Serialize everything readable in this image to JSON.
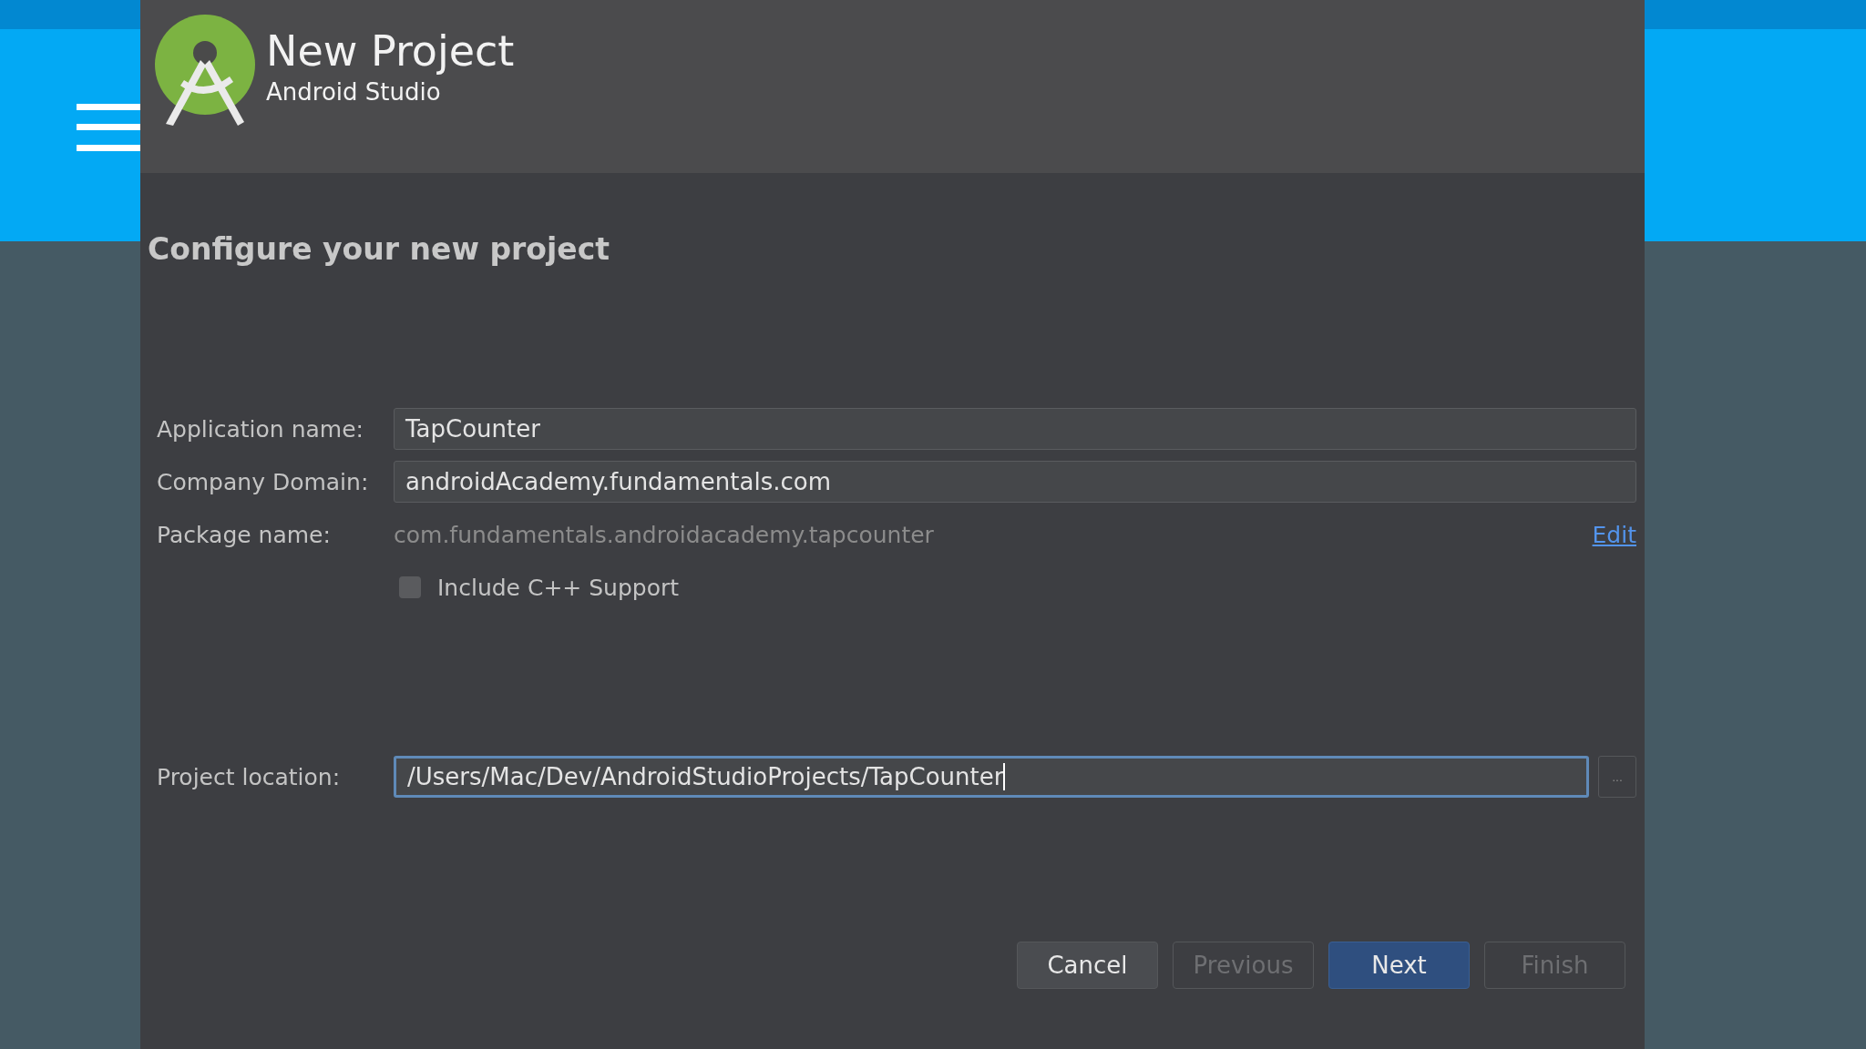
{
  "header": {
    "title": "New Project",
    "subtitle": "Android Studio"
  },
  "heading": "Configure your new project",
  "fields": [
    {
      "kind": "input",
      "label": "Application name:",
      "value": "TapCounter",
      "focused": false
    },
    {
      "kind": "input",
      "label": "Company Domain:",
      "value": "androidAcademy.fundamentals.com",
      "focused": false
    },
    {
      "kind": "readonly",
      "label": "Package name:",
      "value": "com.fundamentals.androidacademy.tapcounter",
      "link": "Edit"
    },
    {
      "kind": "checkbox",
      "label": "Include C++ Support",
      "checked": false
    }
  ],
  "location": {
    "label": "Project location:",
    "value": "/Users/Mac/Dev/AndroidStudioProjects/TapCounter",
    "focused": true,
    "browse": "..."
  },
  "buttons": [
    {
      "label": "Cancel",
      "disabled": false,
      "primary": false
    },
    {
      "label": "Previous",
      "disabled": true,
      "primary": false
    },
    {
      "label": "Next",
      "disabled": false,
      "primary": true
    },
    {
      "label": "Finish",
      "disabled": true,
      "primary": false
    }
  ]
}
